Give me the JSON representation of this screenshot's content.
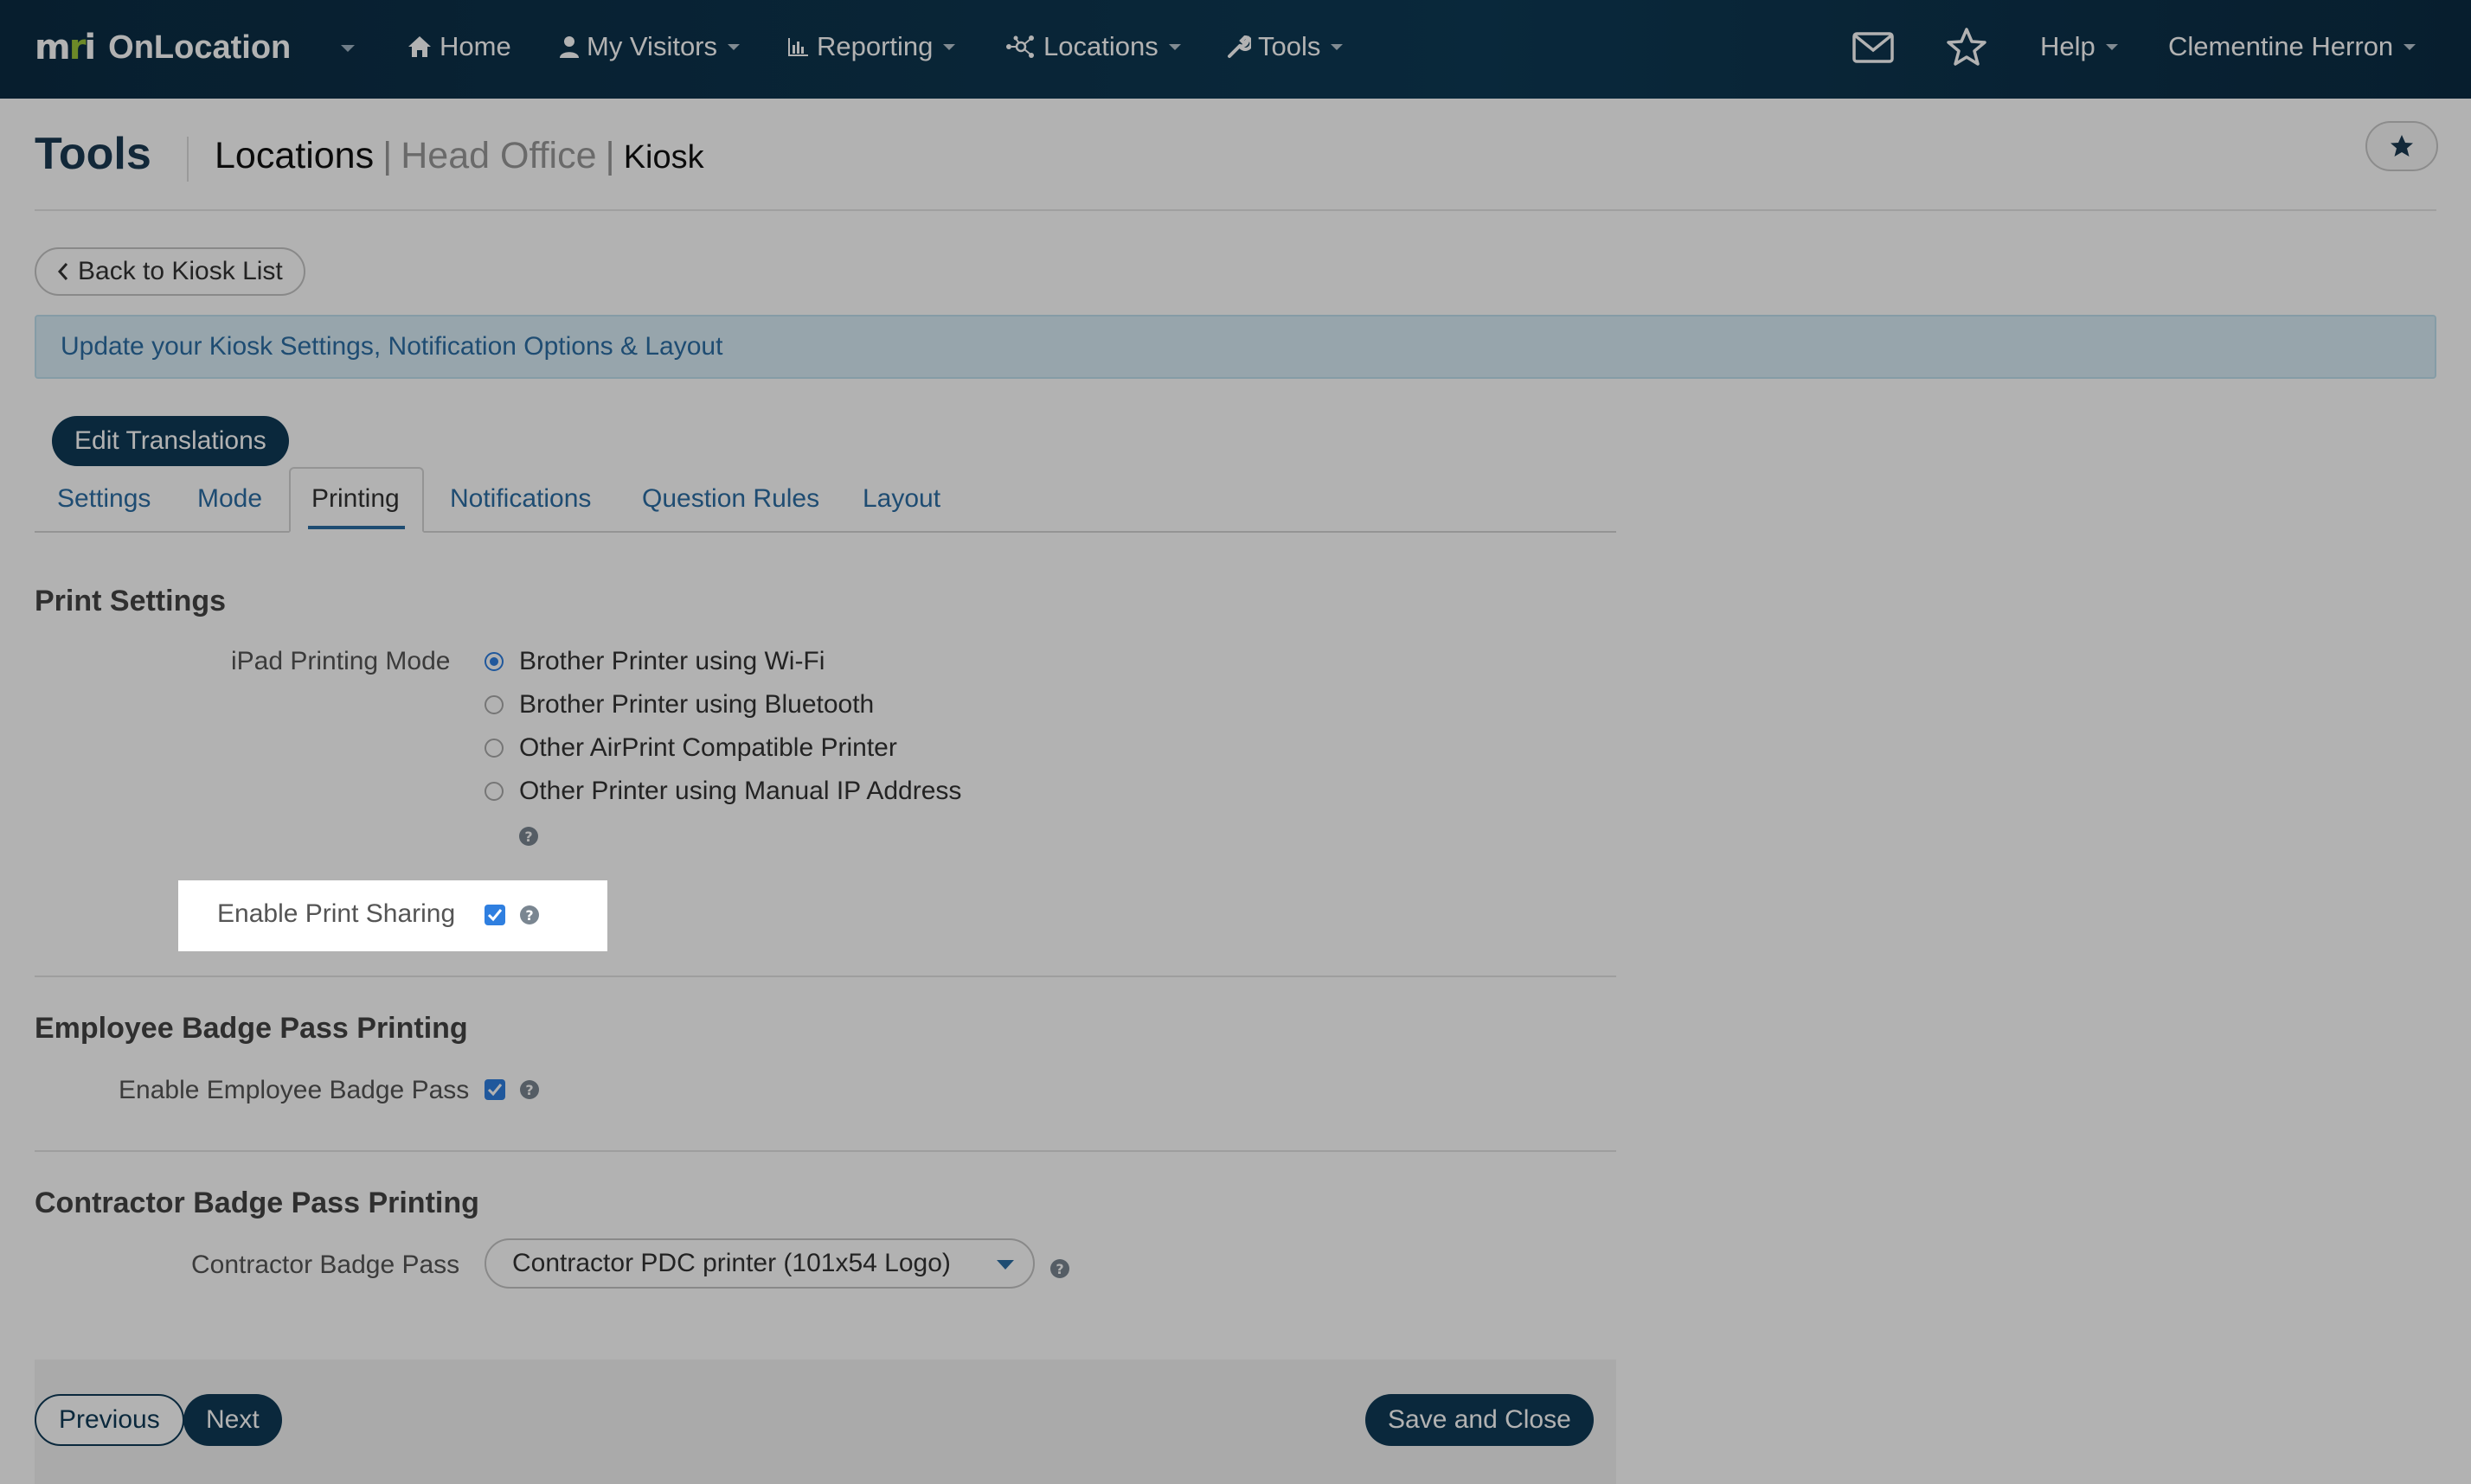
{
  "nav": {
    "logo_mark": "mri",
    "app_name": "OnLocation",
    "items": [
      {
        "label": "Home",
        "icon": "home-icon"
      },
      {
        "label": "My Visitors",
        "icon": "user-icon"
      },
      {
        "label": "Reporting",
        "icon": "chart-icon"
      },
      {
        "label": "Locations",
        "icon": "network-icon"
      },
      {
        "label": "Tools",
        "icon": "wrench-icon"
      }
    ],
    "help_label": "Help",
    "user_name": "Clementine Herron"
  },
  "page": {
    "title": "Tools",
    "breadcrumb": [
      "Locations",
      "Head Office",
      "Kiosk"
    ],
    "back_label": "Back to Kiosk List",
    "info_text": "Update your Kiosk Settings, Notification Options & Layout",
    "edit_translations_label": "Edit Translations"
  },
  "tabs": [
    {
      "label": "Settings",
      "active": false
    },
    {
      "label": "Mode",
      "active": false
    },
    {
      "label": "Printing",
      "active": true
    },
    {
      "label": "Notifications",
      "active": false
    },
    {
      "label": "Question Rules",
      "active": false
    },
    {
      "label": "Layout",
      "active": false
    }
  ],
  "print_settings": {
    "title": "Print Settings",
    "mode_label": "iPad Printing Mode",
    "options": [
      {
        "label": "Brother Printer using Wi-Fi",
        "selected": true
      },
      {
        "label": "Brother Printer using Bluetooth",
        "selected": false
      },
      {
        "label": "Other AirPrint Compatible Printer",
        "selected": false
      },
      {
        "label": "Other Printer using Manual IP Address",
        "selected": false
      }
    ],
    "print_sharing_label": "Enable Print Sharing",
    "print_sharing_checked": true
  },
  "employee_badge": {
    "title": "Employee Badge Pass Printing",
    "label": "Enable Employee Badge Pass",
    "checked": true
  },
  "contractor_badge": {
    "title": "Contractor Badge Pass Printing",
    "label": "Contractor Badge Pass",
    "selected_value": "Contractor PDC printer (101x54 Logo)"
  },
  "footer": {
    "previous_label": "Previous",
    "next_label": "Next",
    "save_label": "Save and Close"
  },
  "colors": {
    "nav_bg": "#0e3a55",
    "accent": "#2c6da4",
    "button_dark": "#0f3a57",
    "info_bg": "#d9edf7"
  }
}
